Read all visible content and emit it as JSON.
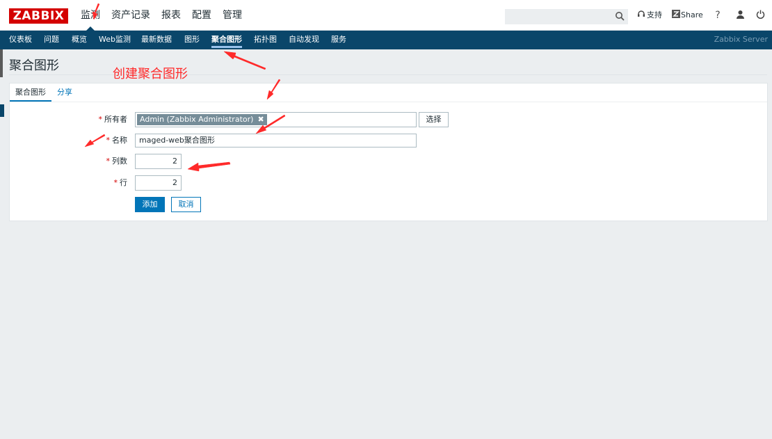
{
  "header": {
    "logo": "ZABBIX",
    "menu": [
      "监测",
      "资产记录",
      "报表",
      "配置",
      "管理"
    ],
    "active_menu": 0,
    "search_value": "",
    "support_label": "支持",
    "share_label": "Share",
    "help_label": "?"
  },
  "subnav": {
    "items": [
      "仪表板",
      "问题",
      "概览",
      "Web监测",
      "最新数据",
      "图形",
      "聚合图形",
      "拓扑图",
      "自动发现",
      "服务"
    ],
    "active_index": 6,
    "server_name": "Zabbix Server"
  },
  "page": {
    "title": "聚合图形",
    "annotation": "创建聚合图形"
  },
  "form": {
    "tabs": [
      "聚合图形",
      "分享"
    ],
    "owner_label": "所有者",
    "owner_value": "Admin (Zabbix Administrator)",
    "select_button": "选择",
    "name_label": "名称",
    "name_value": "maged-web聚合图形",
    "columns_label": "列数",
    "columns_value": "2",
    "rows_label": "行",
    "rows_value": "2",
    "add_button": "添加",
    "cancel_button": "取消",
    "required_mark": "*"
  },
  "colors": {
    "brand": "#d40000",
    "nav_bg": "#0a466a",
    "accent": "#0275b8",
    "annotation": "#ff2a2a"
  }
}
